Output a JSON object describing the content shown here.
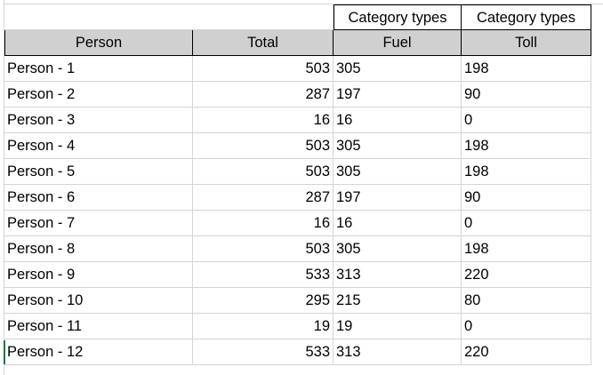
{
  "category_row": {
    "fuel_category": "Category types",
    "toll_category": "Category types"
  },
  "headers": {
    "person": "Person",
    "total": "Total",
    "fuel": "Fuel",
    "toll": "Toll"
  },
  "rows": [
    {
      "person": "Person - 1",
      "total": "503",
      "fuel": "305",
      "toll": "198"
    },
    {
      "person": "Person - 2",
      "total": "287",
      "fuel": "197",
      "toll": "90"
    },
    {
      "person": "Person - 3",
      "total": "16",
      "fuel": "16",
      "toll": "0"
    },
    {
      "person": "Person - 4",
      "total": "503",
      "fuel": "305",
      "toll": "198"
    },
    {
      "person": "Person - 5",
      "total": "503",
      "fuel": "305",
      "toll": "198"
    },
    {
      "person": "Person - 6",
      "total": "287",
      "fuel": "197",
      "toll": "90"
    },
    {
      "person": "Person - 7",
      "total": "16",
      "fuel": "16",
      "toll": "0"
    },
    {
      "person": "Person - 8",
      "total": "503",
      "fuel": "305",
      "toll": "198"
    },
    {
      "person": "Person - 9",
      "total": "533",
      "fuel": "313",
      "toll": "220"
    },
    {
      "person": "Person - 10",
      "total": "295",
      "fuel": "215",
      "toll": "80"
    },
    {
      "person": "Person - 11",
      "total": "19",
      "fuel": "19",
      "toll": "0"
    },
    {
      "person": "Person - 12",
      "total": "533",
      "fuel": "313",
      "toll": "220"
    }
  ]
}
